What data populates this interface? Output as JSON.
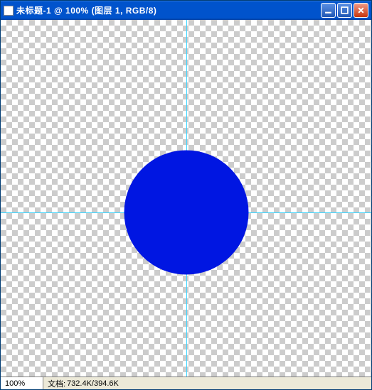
{
  "window": {
    "title": "未标题-1 @ 100% (图层 1, RGB/8)"
  },
  "canvas": {
    "circle_color": "#0016e2",
    "guide_color": "#3cd4ff"
  },
  "statusbar": {
    "zoom": "100%",
    "doc_label": "文档:",
    "doc_size": "732.4K/394.6K"
  }
}
